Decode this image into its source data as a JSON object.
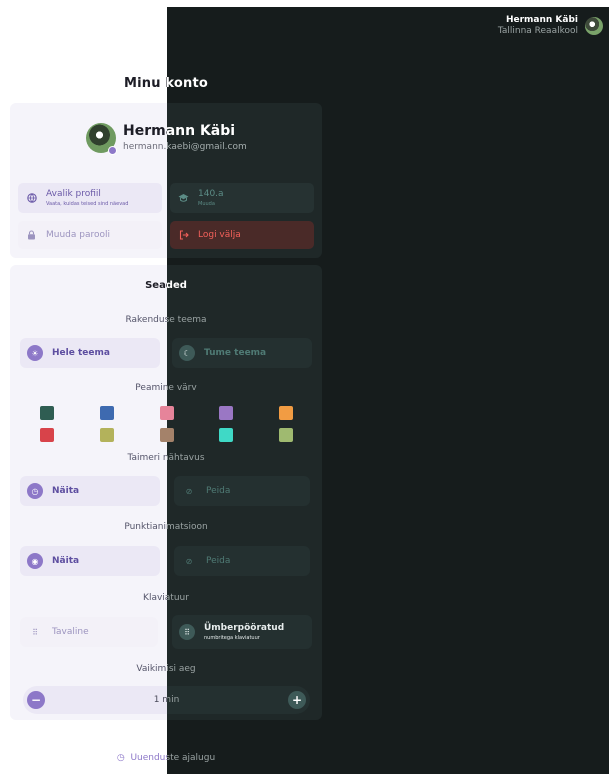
{
  "header": {
    "user_name": "Hermann Käbi",
    "school": "Tallinna Reaalkool"
  },
  "page_title": "Minu konto",
  "profile": {
    "name": "Hermann Käbi",
    "email": "hermann.kaebi@gmail.com"
  },
  "tiles": {
    "public_profile": {
      "label": "Avalik profiil",
      "sub": "Vaata, kuidas teised sind näevad"
    },
    "grade": {
      "label": "140.a",
      "sub": "Muuda"
    },
    "change_password": {
      "label": "Muuda parooli"
    },
    "logout": {
      "label": "Logi välja"
    }
  },
  "settings": {
    "title": "Seaded",
    "theme": {
      "label": "Rakenduse teema",
      "light": "Hele teema",
      "dark": "Tume teema"
    },
    "primary_color": {
      "label": "Peamine värv",
      "colors": [
        "#2f5d52",
        "#3e6ab0",
        "#e6849a",
        "#9a77c4",
        "#f19c43",
        "#d8434a",
        "#b3b25b",
        "#a4826a",
        "#3fd9c6",
        "#9fba70"
      ]
    },
    "timer_visibility": {
      "label": "Taimeri nähtavus",
      "show": "Näita",
      "hide": "Peida"
    },
    "punctuation": {
      "label": "Punktianimatsioon",
      "show": "Näita",
      "hide": "Peida"
    },
    "keyboard": {
      "label": "Klaviatuur",
      "normal": "Tavaline",
      "inverted": "Ümberpööratud",
      "inverted_sub": "numbritega klaviatuur"
    },
    "default_time": {
      "label": "Vaikimisi aeg",
      "value": "1 min",
      "minus": "−",
      "plus": "+"
    }
  },
  "history_link": "Uuenduste ajalugu",
  "icons": {
    "globe": "globe-icon",
    "grad_cap": "graduation-cap-icon",
    "lock": "lock-icon",
    "logout": "logout-icon",
    "sun": "sun-icon",
    "moon": "moon-icon",
    "clock": "clock-icon",
    "eye": "eye-icon",
    "eye_off": "eye-off-icon",
    "keypad": "keypad-icon",
    "history": "history-icon"
  },
  "theme_colors": {
    "accent_light": "#8d78c8",
    "dark_bg": "#161c1c",
    "danger": "#f2605a"
  }
}
